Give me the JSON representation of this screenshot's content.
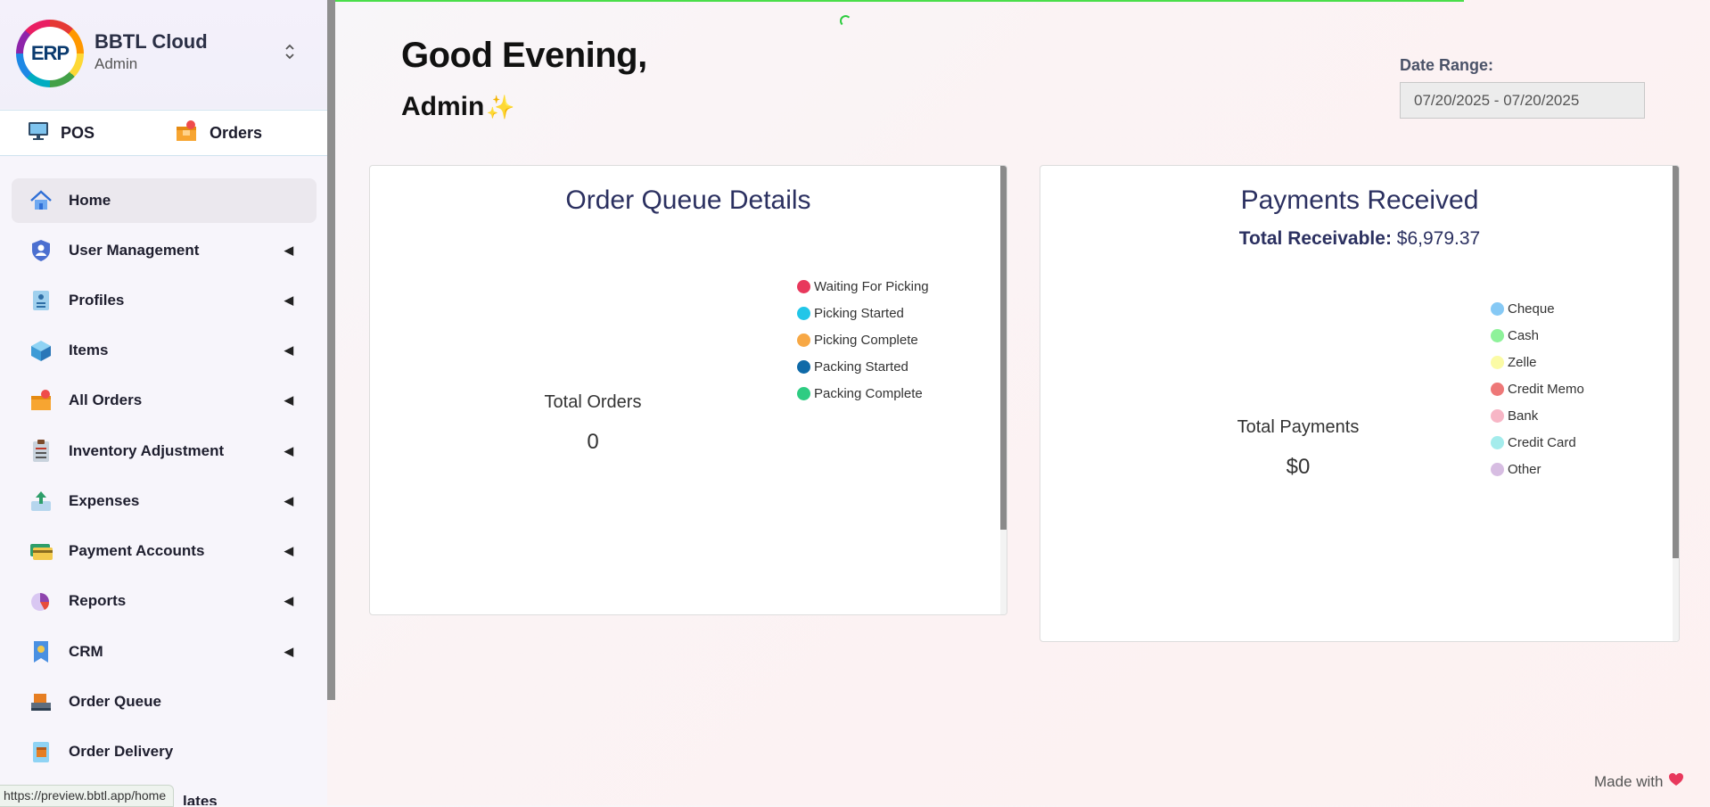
{
  "brand": {
    "name": "BBTL Cloud",
    "role": "Admin",
    "logo_text": "ERP"
  },
  "quick_links": [
    {
      "label": "POS",
      "icon": "monitor-icon"
    },
    {
      "label": "Orders",
      "icon": "orders-box-icon"
    }
  ],
  "nav": [
    {
      "label": "Home",
      "icon": "home-icon",
      "active": true
    },
    {
      "label": "User Management",
      "icon": "user-shield-icon",
      "submenu": true
    },
    {
      "label": "Profiles",
      "icon": "profiles-icon",
      "submenu": true
    },
    {
      "label": "Items",
      "icon": "cube-icon",
      "submenu": true
    },
    {
      "label": "All Orders",
      "icon": "orders-box-icon",
      "submenu": true
    },
    {
      "label": "Inventory Adjustment",
      "icon": "clipboard-icon",
      "submenu": true
    },
    {
      "label": "Expenses",
      "icon": "expenses-icon",
      "submenu": true
    },
    {
      "label": "Payment Accounts",
      "icon": "credit-card-icon",
      "submenu": true
    },
    {
      "label": "Reports",
      "icon": "pie-chart-icon",
      "submenu": true
    },
    {
      "label": "CRM",
      "icon": "crm-badge-icon",
      "submenu": true
    },
    {
      "label": "Order Queue",
      "icon": "order-queue-icon"
    },
    {
      "label": "Order Delivery",
      "icon": "delivery-icon"
    }
  ],
  "nav_peek": "lates",
  "header": {
    "greeting": "Good Evening,",
    "name": "Admin",
    "emoji": "✨"
  },
  "date_range": {
    "label": "Date Range:",
    "value": "07/20/2025 - 07/20/2025"
  },
  "order_queue": {
    "title": "Order Queue Details",
    "center_label": "Total Orders",
    "center_value": "0",
    "legend": [
      {
        "label": "Waiting For Picking",
        "color": "#e8385c"
      },
      {
        "label": "Picking Started",
        "color": "#22c6e8"
      },
      {
        "label": "Picking Complete",
        "color": "#f7a845"
      },
      {
        "label": "Packing Started",
        "color": "#0f6aa8"
      },
      {
        "label": "Packing Complete",
        "color": "#2ecc82"
      }
    ]
  },
  "payments": {
    "title": "Payments Received",
    "receivable_label": "Total Receivable:",
    "receivable_value": "$6,979.37",
    "center_label": "Total Payments",
    "center_value": "$0",
    "legend": [
      {
        "label": "Cheque",
        "color": "#86c9f5"
      },
      {
        "label": "Cash",
        "color": "#8ef29a"
      },
      {
        "label": "Zelle",
        "color": "#fbfba5"
      },
      {
        "label": "Credit Memo",
        "color": "#ee7878"
      },
      {
        "label": "Bank",
        "color": "#f7b6c6"
      },
      {
        "label": "Credit Card",
        "color": "#a4ecec"
      },
      {
        "label": "Other",
        "color": "#d7bde2"
      }
    ]
  },
  "footer": {
    "text": "Made with",
    "icon": "heart-icon"
  },
  "status_url": "https://preview.bbtl.app/home"
}
